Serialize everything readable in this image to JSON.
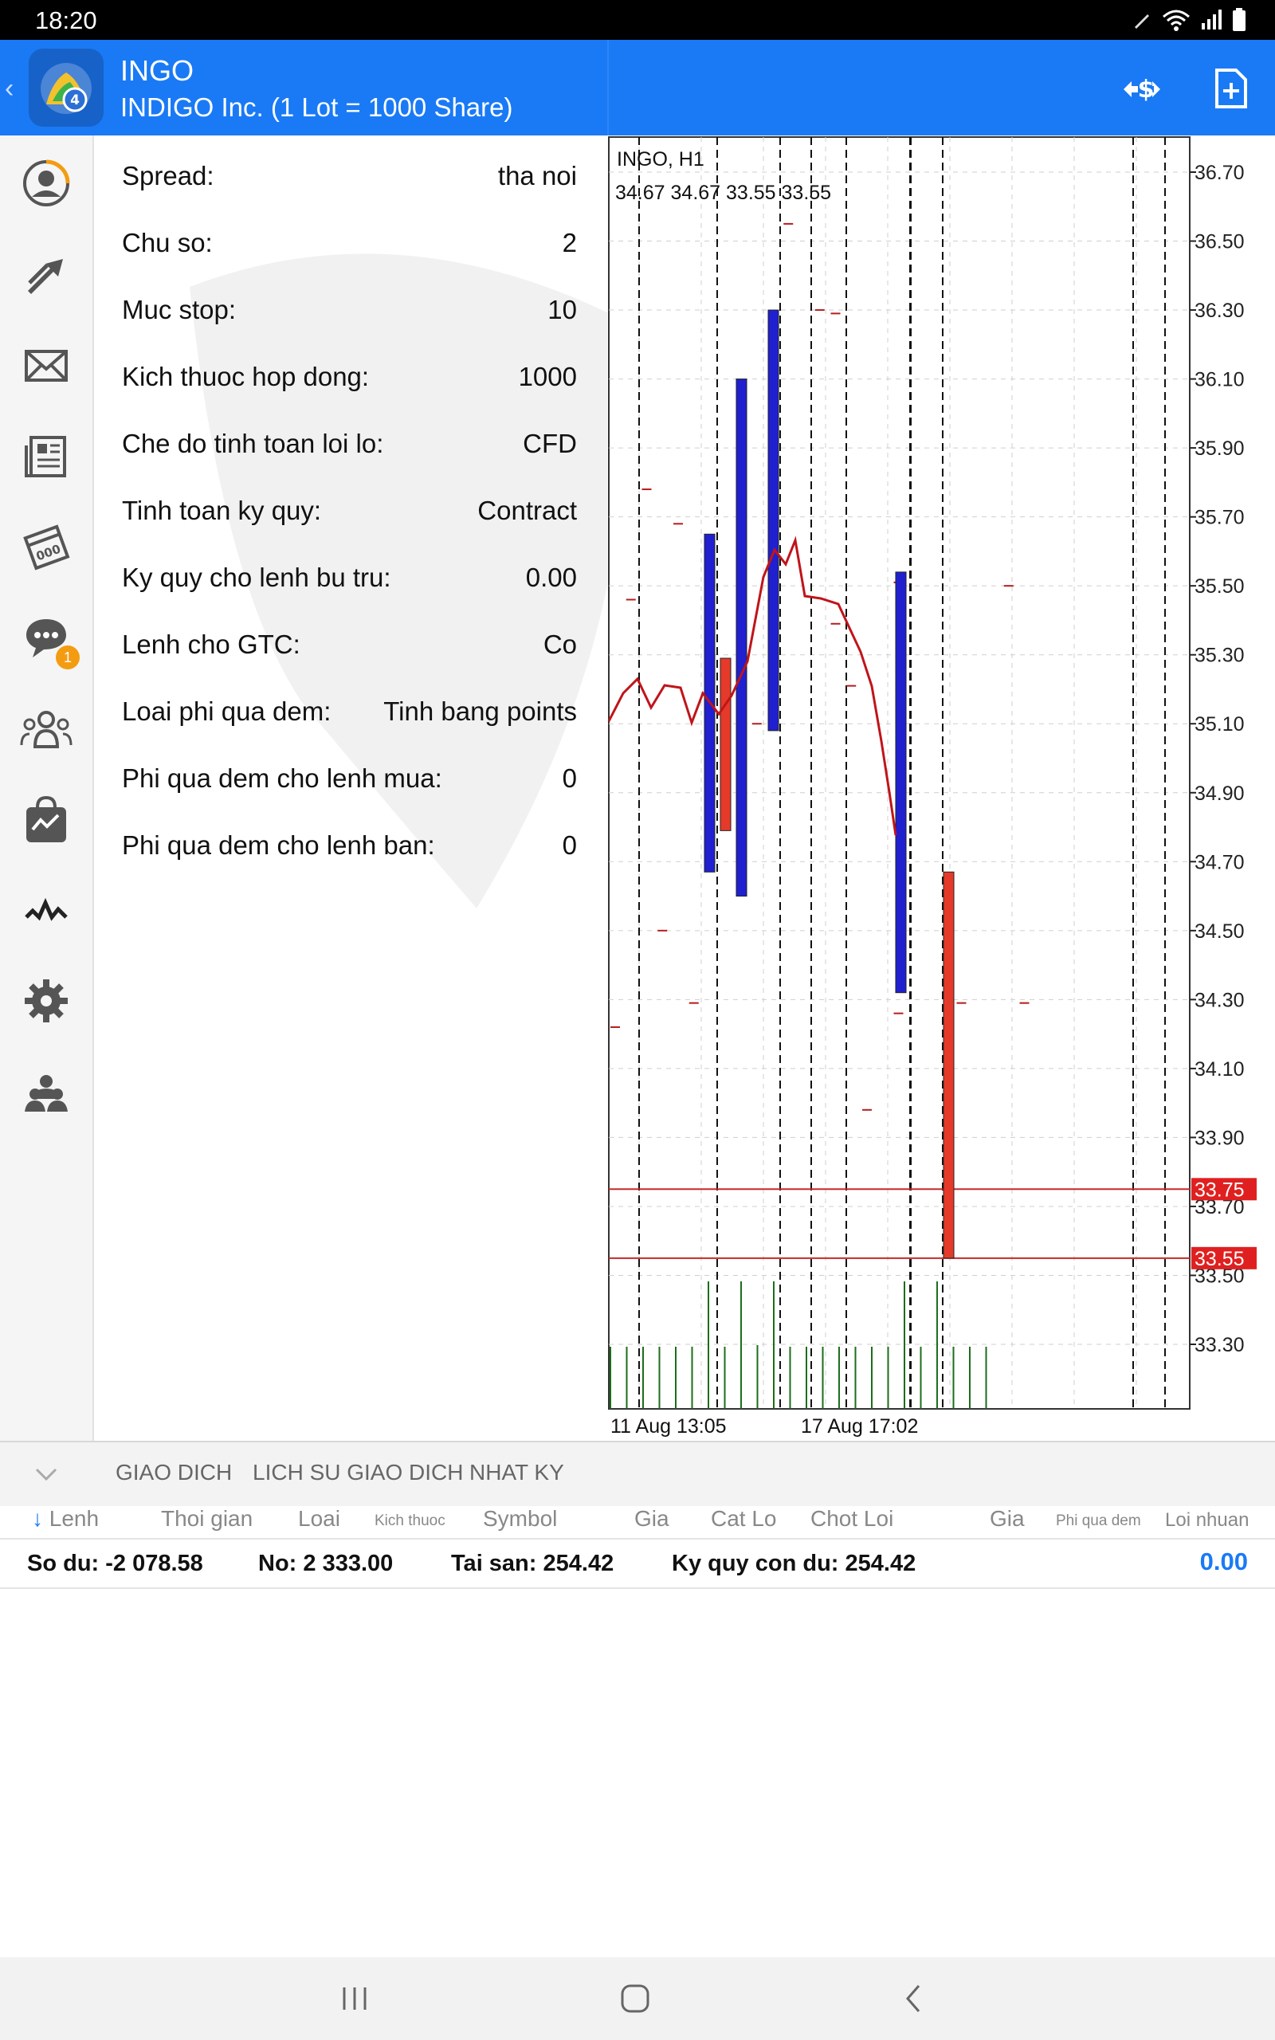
{
  "status_bar": {
    "time": "18:20",
    "icons": [
      "pen-icon",
      "wifi-icon",
      "signal-icon",
      "battery-icon"
    ]
  },
  "header": {
    "symbol": "INGO",
    "description": "INDIGO Inc. (1 Lot = 1000 Share)",
    "buttons": [
      "trade-currency-icon",
      "new-order-icon"
    ]
  },
  "sidebar": {
    "items": [
      {
        "name": "quotes",
        "icon": "account-icon"
      },
      {
        "name": "trade",
        "icon": "trade-arrows-icon"
      },
      {
        "name": "mail",
        "icon": "mail-icon"
      },
      {
        "name": "news",
        "icon": "news-icon"
      },
      {
        "name": "calendar",
        "icon": "calendar-icon"
      },
      {
        "name": "chat",
        "icon": "chat-icon",
        "badge": "1"
      },
      {
        "name": "community",
        "icon": "community-icon"
      },
      {
        "name": "market",
        "icon": "market-bag-icon"
      },
      {
        "name": "signals",
        "icon": "signals-icon"
      },
      {
        "name": "settings",
        "icon": "gear-icon"
      },
      {
        "name": "traders",
        "icon": "traders-icon"
      }
    ]
  },
  "specs": [
    {
      "label": "Spread:",
      "value": "tha noi"
    },
    {
      "label": "Chu so:",
      "value": "2"
    },
    {
      "label": "Muc stop:",
      "value": "10"
    },
    {
      "label": "Kich thuoc hop dong:",
      "value": "1000"
    },
    {
      "label": "Che do tinh toan loi lo:",
      "value": "CFD"
    },
    {
      "label": "Tinh toan ky quy:",
      "value": "Contract"
    },
    {
      "label": "Ky quy cho lenh bu tru:",
      "value": "0.00"
    },
    {
      "label": "Lenh cho GTC:",
      "value": "Co"
    },
    {
      "label": "Loai phi qua dem:",
      "value": "Tinh bang points"
    },
    {
      "label": "Phi qua dem cho lenh mua:",
      "value": "0"
    },
    {
      "label": "Phi qua dem cho lenh ban:",
      "value": "0"
    }
  ],
  "chart_data": {
    "type": "bar",
    "symbol_label": "INGO, H1",
    "ohlc_label": "34.67 34.67 33.55 33.55",
    "y_ticks": [
      "36.70",
      "36.50",
      "36.30",
      "36.10",
      "35.90",
      "35.70",
      "35.50",
      "35.30",
      "35.10",
      "34.90",
      "34.70",
      "34.50",
      "34.30",
      "34.10",
      "33.90",
      "33.70",
      "33.50",
      "33.30"
    ],
    "ylim": [
      33.2,
      36.78
    ],
    "x_labels": [
      "11 Aug 13:05",
      "17 Aug 17:02"
    ],
    "price_lines": [
      {
        "value": 33.75,
        "label": "33.75",
        "color": "#c62828"
      },
      {
        "value": 33.55,
        "label": "33.55",
        "color": "#c62828"
      }
    ],
    "bars": [
      {
        "slot": 3,
        "high": 35.65,
        "low": 34.67,
        "color": "#2020d0"
      },
      {
        "slot": 4,
        "high": 35.29,
        "low": 34.79,
        "color": "#e53a2a"
      },
      {
        "slot": 5,
        "high": 36.1,
        "low": 34.6,
        "color": "#2020d0"
      },
      {
        "slot": 6,
        "high": 36.3,
        "low": 35.08,
        "color": "#2020d0"
      },
      {
        "slot": 12,
        "high": 35.54,
        "low": 34.32,
        "color": "#2020d0"
      },
      {
        "slot": 13,
        "high": 34.67,
        "low": 33.55,
        "color": "#e53a2a"
      }
    ],
    "dashes": [
      {
        "slot": 0,
        "value": 34.22
      },
      {
        "slot": 0.5,
        "value": 35.46
      },
      {
        "slot": 1,
        "value": 35.78
      },
      {
        "slot": 1.5,
        "value": 34.5
      },
      {
        "slot": 2,
        "value": 35.68
      },
      {
        "slot": 2.5,
        "value": 34.29
      },
      {
        "slot": 4.5,
        "value": 35.1
      },
      {
        "slot": 5.5,
        "value": 36.55
      },
      {
        "slot": 6.5,
        "value": 36.3
      },
      {
        "slot": 7,
        "value": 35.39
      },
      {
        "slot": 7.5,
        "value": 35.21
      },
      {
        "slot": 7,
        "value": 36.29
      },
      {
        "slot": 8,
        "value": 33.98
      },
      {
        "slot": 9,
        "value": 34.26
      },
      {
        "slot": 9,
        "value": 35.51
      },
      {
        "slot": 11,
        "value": 34.29
      },
      {
        "slot": 12.5,
        "value": 35.5
      },
      {
        "slot": 13,
        "value": 34.29
      }
    ],
    "ma_line": [
      [
        0,
        35.13
      ],
      [
        1,
        35.26
      ],
      [
        2,
        35.2
      ],
      [
        3,
        35.24
      ],
      [
        4,
        35.1
      ],
      [
        5,
        35.22
      ],
      [
        6,
        35.11
      ],
      [
        7,
        35.18
      ],
      [
        8,
        35.28
      ],
      [
        9,
        35.53
      ],
      [
        10,
        35.58
      ],
      [
        11,
        35.55
      ],
      [
        12,
        35.62
      ],
      [
        13,
        35.46
      ],
      [
        14,
        35.45
      ],
      [
        15,
        35.42
      ],
      [
        16,
        35.33
      ],
      [
        17,
        35.1
      ],
      [
        18,
        34.77
      ]
    ],
    "volume": [
      62,
      62,
      62,
      62,
      62,
      62,
      62,
      62,
      62,
      62,
      62,
      62,
      62,
      62,
      62,
      62,
      62,
      62,
      62,
      62,
      62,
      62,
      62,
      62
    ],
    "volume_heights": [
      78,
      78,
      78,
      78,
      78,
      78,
      160,
      78,
      160,
      80,
      160,
      78,
      78,
      78,
      78,
      78,
      78,
      78,
      160,
      78,
      160,
      78,
      78,
      78
    ],
    "grid": true,
    "colors": {
      "bull": "#2020d0",
      "bear": "#e53a2a",
      "ma": "#c0141a",
      "volume": "#1b6e1b",
      "tick": "#222"
    }
  },
  "bottom_tabs": [
    "GIAO DICH",
    "LICH SU GIAO DICH",
    "NHAT KY"
  ],
  "columns": [
    {
      "label": "Lenh",
      "sort": "↓"
    },
    {
      "label": "Thoi gian"
    },
    {
      "label": "Loai"
    },
    {
      "label": "Kich thuoc",
      "small": true
    },
    {
      "label": "Symbol"
    },
    {
      "label": "Gia"
    },
    {
      "label": "Cat Lo"
    },
    {
      "label": "Chot Loi"
    },
    {
      "label": "Gia"
    },
    {
      "label": "Phi qua dem",
      "small": true
    },
    {
      "label": "Loi nhuan"
    }
  ],
  "balance": {
    "so_du_label": "So du:",
    "so_du": "-2 078.58",
    "no_label": "No:",
    "no": "2 333.00",
    "tai_san_label": "Tai san:",
    "tai_san": "254.42",
    "ky_quy_label": "Ky quy con du:",
    "ky_quy": "254.42",
    "profit": "0.00"
  }
}
